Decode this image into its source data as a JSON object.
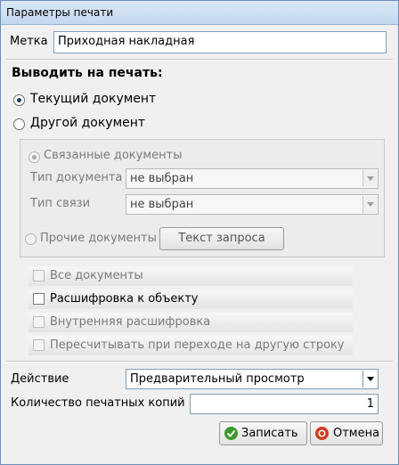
{
  "window": {
    "title": "Параметры печати"
  },
  "label_field": {
    "label": "Метка",
    "value": "Приходная накладная"
  },
  "print_section": {
    "heading": "Выводить на печать:",
    "current_doc": "Текущий документ",
    "other_doc": "Другой документ",
    "selected": "current_doc"
  },
  "other_group": {
    "related_docs": "Связанные документы",
    "doc_type_label": "Тип документа",
    "doc_type_value": "не выбран",
    "link_type_label": "Тип связи",
    "link_type_value": "не выбран",
    "other_docs": "Прочие документы",
    "query_button": "Текст запроса"
  },
  "options": {
    "all_docs": "Все документы",
    "decode_to_object": "Расшифровка к объекту",
    "internal_decode": "Внутренняя расшифровка",
    "recalc_on_row_change": "Пересчитывать при переходе на другую строку"
  },
  "action": {
    "label": "Действие",
    "value": "Предварительный просмотр"
  },
  "copies": {
    "label": "Количество печатных копий",
    "value": "1"
  },
  "buttons": {
    "save": "Записать",
    "cancel": "Отмена"
  },
  "colors": {
    "save_icon": "#3c9a2a",
    "cancel_icon": "#d23a1e"
  }
}
